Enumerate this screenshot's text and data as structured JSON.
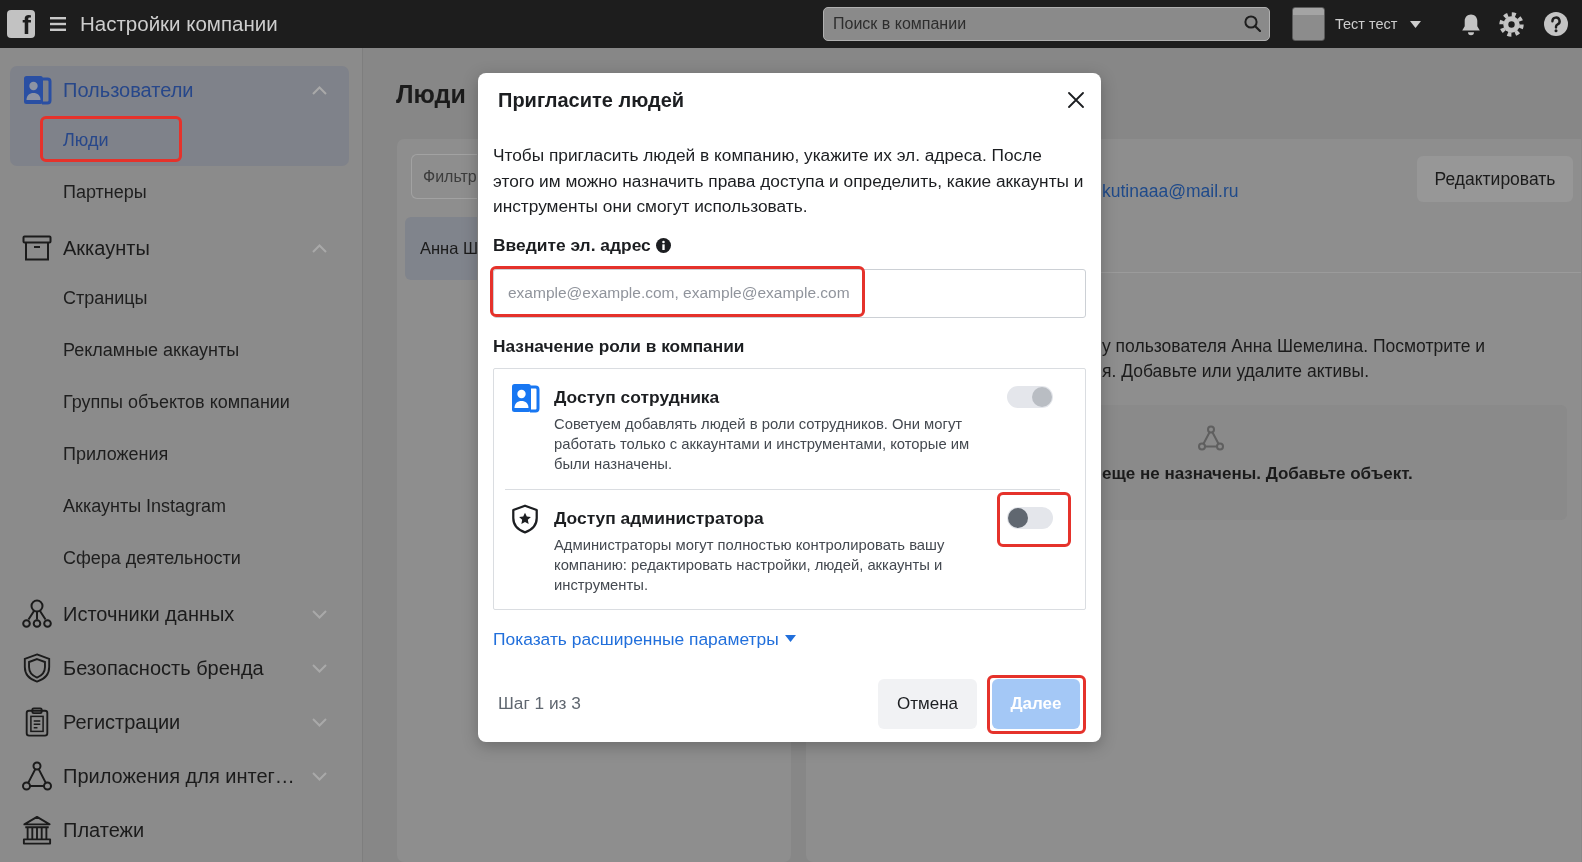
{
  "top_bar": {
    "logo": "f",
    "title": "Настройки компании",
    "search": {
      "placeholder": "Поиск в компании"
    },
    "account": {
      "name": "Тест тест"
    }
  },
  "sidebar": {
    "groups": [
      {
        "label": "Пользователи",
        "selected": true,
        "expanded": true,
        "children": [
          {
            "label": "Люди",
            "selected": true,
            "highlighted": true
          },
          {
            "label": "Партнеры",
            "selected": false,
            "highlighted": false
          }
        ]
      },
      {
        "label": "Аккаунты",
        "selected": false,
        "expanded": true,
        "children": [
          {
            "label": "Страницы",
            "selected": false,
            "highlighted": false
          },
          {
            "label": "Рекламные аккаунты",
            "selected": false,
            "highlighted": false
          },
          {
            "label": "Группы объектов компании",
            "selected": false,
            "highlighted": false
          },
          {
            "label": "Приложения",
            "selected": false,
            "highlighted": false
          },
          {
            "label": "Аккаунты Instagram",
            "selected": false,
            "highlighted": false
          },
          {
            "label": "Сфера деятельности",
            "selected": false,
            "highlighted": false
          }
        ]
      },
      {
        "label": "Источники данных",
        "selected": false,
        "expanded": false
      },
      {
        "label": "Безопасность бренда",
        "selected": false,
        "expanded": false
      },
      {
        "label": "Регистрации",
        "selected": false,
        "expanded": false
      },
      {
        "label": "Приложения для интег…",
        "selected": false,
        "expanded": false
      },
      {
        "label": "Платежи",
        "selected": false
      }
    ]
  },
  "main": {
    "title": "Люди",
    "filter": {
      "placeholder": "Фильтр"
    },
    "people": [
      {
        "name": "Анна Ш",
        "selected": true
      }
    ],
    "detail": {
      "email": "kutinaaa@mail.ru",
      "edit_button": "Редактировать",
      "lines": [
        "у пользователя Анна Шемелина. Посмотрите и",
        "я. Добавьте или удалите активы."
      ],
      "empty_text": "еще не назначены. Добавьте объект."
    }
  },
  "dialog": {
    "title": "Пригласите людей",
    "intro": "Чтобы пригласить людей в компанию, укажите их эл. адреса. После этого им можно назначить права доступа и определить, какие аккаунты и инструменты они смогут использовать.",
    "email_field": {
      "label": "Введите эл. адрес",
      "placeholder": "example@example.com, example@example.com",
      "highlighted": true
    },
    "roles_heading": "Назначение роли в компании",
    "roles": [
      {
        "title": "Доступ сотрудника",
        "description": "Советуем добавлять людей в роли сотрудников. Они могут работать только с аккаунтами и инструментами, которые им были назначены.",
        "on": true,
        "disabled": true,
        "highlighted": false
      },
      {
        "title": "Доступ администратора",
        "description": "Администраторы могут полностью контролировать вашу компанию: редактировать настройки, людей, аккаунты и инструменты.",
        "on": false,
        "disabled": false,
        "highlighted": true
      }
    ],
    "advanced_link": "Показать расширенные параметры",
    "step": "Шаг 1 из 3",
    "buttons": [
      {
        "label": "Отмена",
        "kind": "secondary",
        "disabled": false,
        "highlighted": false
      },
      {
        "label": "Далее",
        "kind": "primary",
        "disabled": true,
        "highlighted": true
      }
    ]
  }
}
